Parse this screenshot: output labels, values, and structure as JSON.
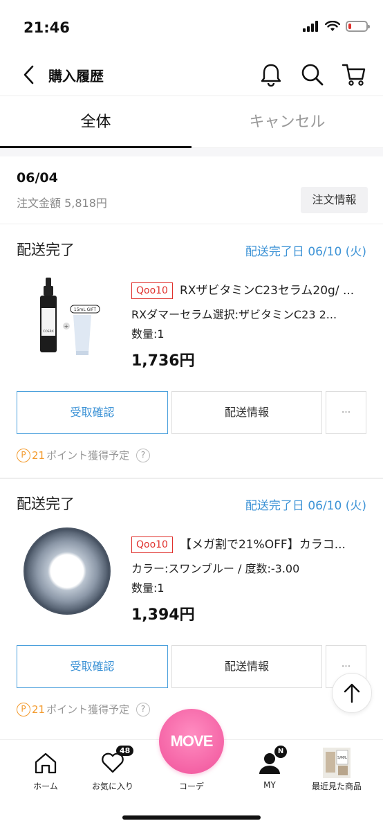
{
  "status_bar": {
    "time": "21:46",
    "battery_level": 0.15
  },
  "header": {
    "title": "購入履歴"
  },
  "tabs": [
    {
      "label": "全体",
      "active": true
    },
    {
      "label": "キャンセル",
      "active": false
    }
  ],
  "order": {
    "date": "06/04",
    "amount": "注文金額 5,818円",
    "info_button": "注文情報"
  },
  "items": [
    {
      "status": "配送完了",
      "delivery_date": "配送完了日 06/10 (火)",
      "shop_badge": "Qoo10",
      "title": "RXザビタミンC23セラム20g/ ...",
      "option": "RXダマーセラム選択:ザビタミンC23 2...",
      "quantity": "数量:1",
      "price": "1,736円",
      "thumb_tag": "15mL GIFT",
      "thumb_brand": "COSRX",
      "confirm_button": "受取確認",
      "delivery_info_button": "配送情報",
      "more_button": "···",
      "points_num": "21",
      "points_text": "ポイント獲得予定"
    },
    {
      "status": "配送完了",
      "delivery_date": "配送完了日 06/10 (火)",
      "shop_badge": "Qoo10",
      "title": "【メガ割で21%OFF】カラコ...",
      "option": "カラー:スワンブルー / 度数:-3.00",
      "quantity": "数量:1",
      "price": "1,394円",
      "confirm_button": "受取確認",
      "delivery_info_button": "配送情報",
      "more_button": "···",
      "points_num": "21",
      "points_text": "ポイント獲得予定"
    }
  ],
  "bottom_nav": {
    "home": "ホーム",
    "favorites": "お気に入り",
    "favorites_count": "48",
    "coordinate": "コーデ",
    "move_logo": "MOVE",
    "my": "MY",
    "my_badge": "N",
    "recent": "最近見た商品"
  },
  "icons": {
    "back": "chevron-left-icon",
    "bell": "bell-icon",
    "search": "search-icon",
    "cart": "cart-icon",
    "scroll_top": "arrow-up-icon"
  },
  "colors": {
    "accent_blue": "#3d93d6",
    "qoo10_red": "#e0312d",
    "points_orange": "#f39a2d",
    "move_pink": "#f0529a"
  }
}
